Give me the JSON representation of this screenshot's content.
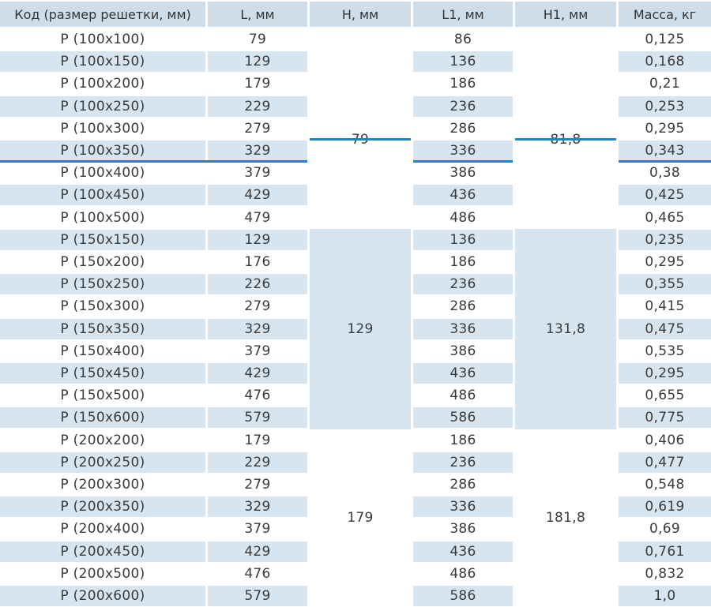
{
  "headers": [
    "Код (размер решетки, мм)",
    "L, мм",
    "H, мм",
    "L1, мм",
    "H1, мм",
    "Масса, кг"
  ],
  "rows": [
    {
      "code": "P (100x100)",
      "l": "79",
      "l1": "86",
      "mass": "0,125"
    },
    {
      "code": "P (100x150)",
      "l": "129",
      "l1": "136",
      "mass": "0,168"
    },
    {
      "code": "P (100x200)",
      "l": "179",
      "l1": "186",
      "mass": "0,21"
    },
    {
      "code": "P (100x250)",
      "l": "229",
      "l1": "236",
      "mass": "0,253"
    },
    {
      "code": "P (100x300)",
      "l": "279",
      "l1": "286",
      "mass": "0,295"
    },
    {
      "code": "P (100x350)",
      "l": "329",
      "l1": "336",
      "mass": "0,343"
    },
    {
      "code": "P (100x400)",
      "l": "379",
      "l1": "386",
      "mass": "0,38"
    },
    {
      "code": "P (100x450)",
      "l": "429",
      "l1": "436",
      "mass": "0,425"
    },
    {
      "code": "P (100x500)",
      "l": "479",
      "l1": "486",
      "mass": "0,465"
    },
    {
      "code": "P (150x150)",
      "l": "129",
      "l1": "136",
      "mass": "0,235"
    },
    {
      "code": "P (150x200)",
      "l": "176",
      "l1": "186",
      "mass": "0,295"
    },
    {
      "code": "P (150x250)",
      "l": "226",
      "l1": "236",
      "mass": "0,355"
    },
    {
      "code": "P (150x300)",
      "l": "279",
      "l1": "286",
      "mass": "0,415"
    },
    {
      "code": "P (150x350)",
      "l": "329",
      "l1": "336",
      "mass": "0,475"
    },
    {
      "code": "P (150x400)",
      "l": "379",
      "l1": "386",
      "mass": "0,535"
    },
    {
      "code": "P (150x450)",
      "l": "429",
      "l1": "436",
      "mass": "0,295"
    },
    {
      "code": "P (150x500)",
      "l": "476",
      "l1": "486",
      "mass": "0,655"
    },
    {
      "code": "P (150x600)",
      "l": "579",
      "l1": "586",
      "mass": "0,775"
    },
    {
      "code": "P (200x200)",
      "l": "179",
      "l1": "186",
      "mass": "0,406"
    },
    {
      "code": "P (200x250)",
      "l": "229",
      "l1": "236",
      "mass": "0,477"
    },
    {
      "code": "P (200x300)",
      "l": "279",
      "l1": "286",
      "mass": "0,548"
    },
    {
      "code": "P (200x350)",
      "l": "329",
      "l1": "336",
      "mass": "0,619"
    },
    {
      "code": "P (200x400)",
      "l": "379",
      "l1": "386",
      "mass": "0,69"
    },
    {
      "code": "P (200x450)",
      "l": "429",
      "l1": "436",
      "mass": "0,761"
    },
    {
      "code": "P (200x500)",
      "l": "476",
      "l1": "486",
      "mass": "0,832"
    },
    {
      "code": "P (200x600)",
      "l": "579",
      "l1": "586",
      "mass": "1,0"
    }
  ],
  "groups": [
    {
      "h": "79",
      "h1": "81,8",
      "rows": 9
    },
    {
      "h": "129",
      "h1": "131,8",
      "rows": 9
    },
    {
      "h": "179",
      "h1": "181,8",
      "rows": 8
    }
  ],
  "colors": {
    "stripe": "#d7e5f0",
    "header": "#cfdde9",
    "accent_line": "#1a86cf"
  }
}
